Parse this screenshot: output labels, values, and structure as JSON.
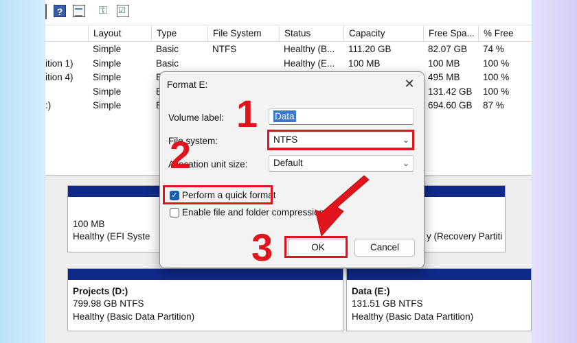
{
  "dialog": {
    "title": "Format E:",
    "close_glyph": "✕",
    "volume_label": {
      "label": "Volume label:",
      "value": "Data"
    },
    "file_system": {
      "label": "File system:",
      "value": "NTFS"
    },
    "allocation": {
      "label": "Allocation unit size:",
      "value": "Default"
    },
    "quick_format": {
      "label": "Perform a quick format",
      "checked": true
    },
    "compression": {
      "label": "Enable file and folder compression",
      "checked": false
    },
    "ok_label": "OK",
    "cancel_label": "Cancel"
  },
  "toolbar": {
    "help_glyph": "?",
    "key_glyph": "⚿",
    "check_glyph": "☑"
  },
  "table": {
    "columns": [
      "Layout",
      "Type",
      "File System",
      "Status",
      "Capacity",
      "Free Spa...",
      "% Free"
    ],
    "rows": [
      {
        "volume": "",
        "layout": "Simple",
        "type": "Basic",
        "fs": "NTFS",
        "status": "Healthy (B...",
        "capacity": "111.20 GB",
        "free": "82.07 GB",
        "pct": "74 %"
      },
      {
        "volume": "ition 1)",
        "layout": "Simple",
        "type": "Basic",
        "fs": "",
        "status": "Healthy (E...",
        "capacity": "100 MB",
        "free": "100 MB",
        "pct": "100 %"
      },
      {
        "volume": "ition 4)",
        "layout": "Simple",
        "type": "E",
        "fs": "",
        "status": "",
        "capacity": "",
        "free": "495 MB",
        "pct": "100 %"
      },
      {
        "volume": "",
        "layout": "Simple",
        "type": "E",
        "fs": "",
        "status": "",
        "capacity": "",
        "free": "131.42 GB",
        "pct": "100 %"
      },
      {
        "volume": ":)",
        "layout": "Simple",
        "type": "E",
        "fs": "",
        "status": "",
        "capacity": "",
        "free": "694.60 GB",
        "pct": "87 %"
      }
    ]
  },
  "partitions": {
    "efi": {
      "size": "100 MB",
      "status": "Healthy (EFI Syste"
    },
    "recovery": {
      "status": "y (Recovery Partiti"
    },
    "projects": {
      "name": "Projects  (D:)",
      "size": "799.98 GB NTFS",
      "status": "Healthy (Basic Data Partition)"
    },
    "data": {
      "name": "Data  (E:)",
      "size": "131.51 GB NTFS",
      "status": "Healthy (Basic Data Partition)"
    }
  },
  "annotations": {
    "step1": "1",
    "step2": "2",
    "step3": "3"
  },
  "colors": {
    "highlight": "#e0141c",
    "partition_bar": "#0f2a8a",
    "checkbox": "#1d5fb3"
  }
}
